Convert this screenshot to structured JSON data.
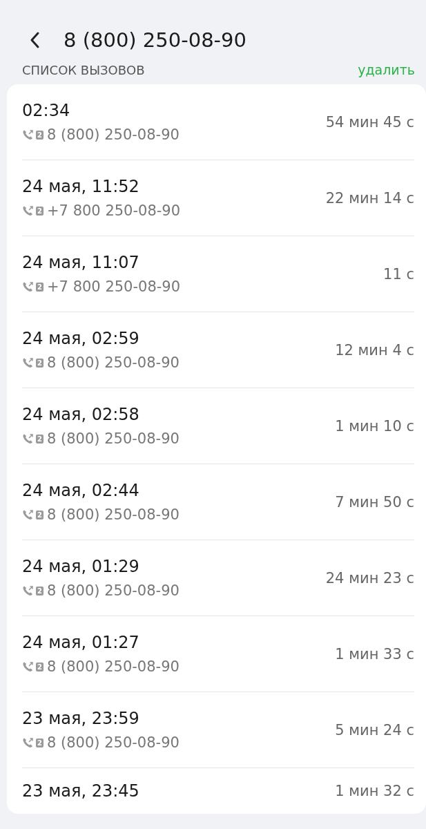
{
  "header": {
    "title": "8 (800) 250-08-90"
  },
  "section": {
    "title": "СПИСОК ВЫЗОВОВ",
    "action": "удалить"
  },
  "calls": [
    {
      "time": "02:34",
      "sim": "2",
      "number": "8 (800) 250-08-90",
      "duration": "54 мин 45 с"
    },
    {
      "time": "24 мая, 11:52",
      "sim": "2",
      "number": "+7 800 250-08-90",
      "duration": "22 мин 14 с"
    },
    {
      "time": "24 мая, 11:07",
      "sim": "2",
      "number": "+7 800 250-08-90",
      "duration": "11 с"
    },
    {
      "time": "24 мая, 02:59",
      "sim": "2",
      "number": "8 (800) 250-08-90",
      "duration": "12 мин 4 с"
    },
    {
      "time": "24 мая, 02:58",
      "sim": "2",
      "number": "8 (800) 250-08-90",
      "duration": "1 мин 10 с"
    },
    {
      "time": "24 мая, 02:44",
      "sim": "2",
      "number": "8 (800) 250-08-90",
      "duration": "7 мин 50 с"
    },
    {
      "time": "24 мая, 01:29",
      "sim": "2",
      "number": "8 (800) 250-08-90",
      "duration": "24 мин 23 с"
    },
    {
      "time": "24 мая, 01:27",
      "sim": "2",
      "number": "8 (800) 250-08-90",
      "duration": "1 мин 33 с"
    },
    {
      "time": "23 мая, 23:59",
      "sim": "2",
      "number": "8 (800) 250-08-90",
      "duration": "5 мин 24 с"
    },
    {
      "time": "23 мая, 23:45",
      "duration": "1 мин 32 с"
    }
  ]
}
